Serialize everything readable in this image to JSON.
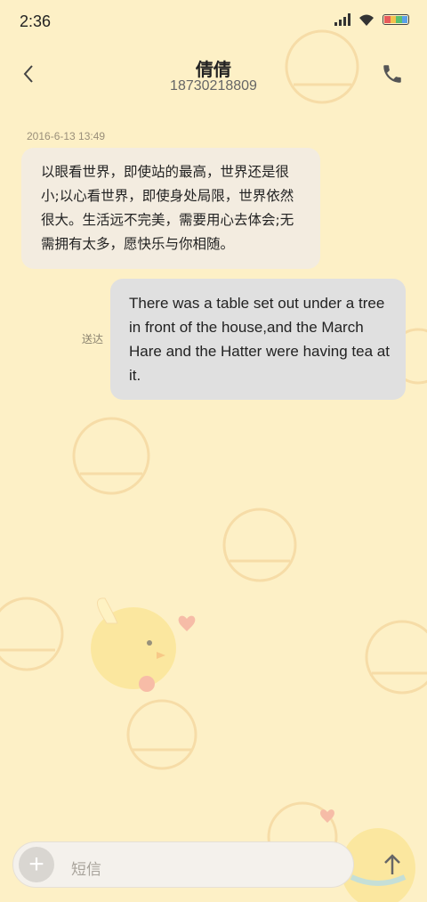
{
  "status_bar": {
    "time": "2:36",
    "battery_colors": [
      "#e85b5b",
      "#f2c14e",
      "#5bc16e",
      "#5aa0e8"
    ]
  },
  "header": {
    "contact_name": "倩倩",
    "phone_number": "18730218809",
    "back_icon": "chevron-left-icon",
    "call_icon": "phone-icon"
  },
  "conversation": {
    "timestamp": "2016-6-13 13:49",
    "incoming_message": "以眼看世界，即使站的最高，世界还是很小;以心看世界，即使身处局限，世界依然很大。生活远不完美，需要用心去体会;无需拥有太多，愿快乐与你相随。",
    "outgoing_message": "There was a table set out under a tree in front of the house,and the March Hare and the Hatter were having tea at it.",
    "outgoing_status": "送达"
  },
  "composer": {
    "add_icon": "plus-icon",
    "placeholder": "短信",
    "send_icon": "send-arrow-icon"
  },
  "colors": {
    "background": "#fdf0c6",
    "incoming_bubble": "#f3ece0",
    "outgoing_bubble": "#e0e0e0"
  }
}
